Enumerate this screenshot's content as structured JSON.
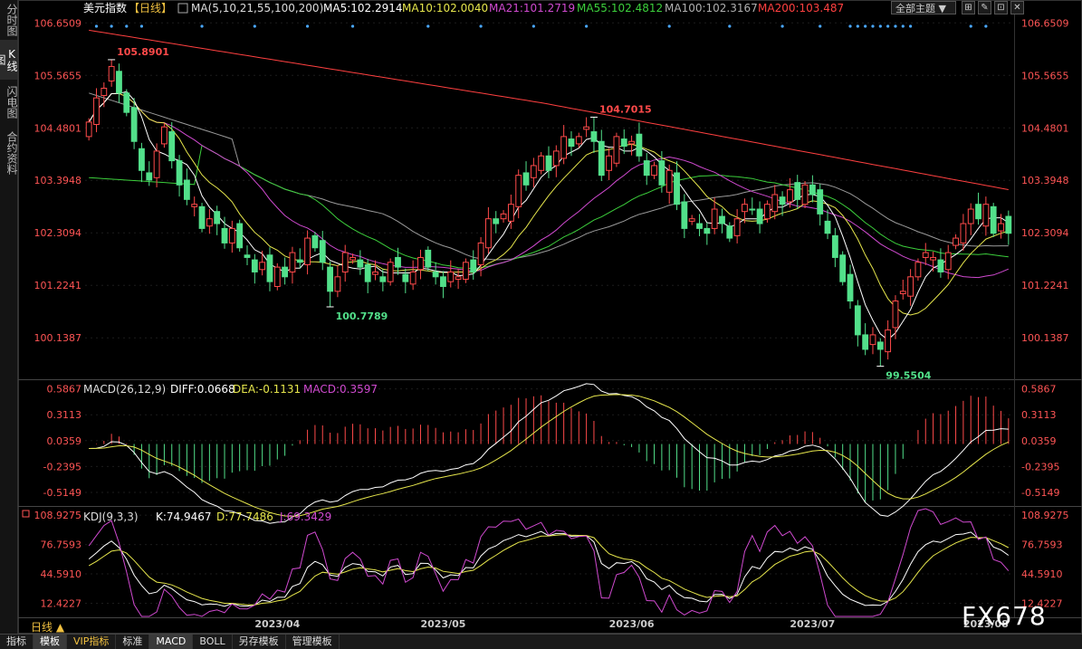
{
  "side_tabs": [
    "分时图",
    "K线图",
    "闪电图",
    "合约资料"
  ],
  "header": {
    "title": "美元指数",
    "period_tag": "【日线】",
    "ma_label": "MA(5,10,21,55,100,200)",
    "ma_values": [
      {
        "label": "MA5:102.2914",
        "color": "#ffffff"
      },
      {
        "label": "MA10:102.0040",
        "color": "#e6e64c"
      },
      {
        "label": "MA21:101.2719",
        "color": "#d04ad0"
      },
      {
        "label": "MA55:102.4812",
        "color": "#3ccf3c"
      },
      {
        "label": "MA100:102.3167",
        "color": "#b0b0b0"
      },
      {
        "label": "MA200:103.487",
        "color": "#ff4040"
      }
    ],
    "theme_button": "全部主题"
  },
  "macd_header": {
    "title": "MACD(26,12,9)",
    "diff": "DIFF:0.0668",
    "dea": "DEA:-0.1131",
    "macd": "MACD:0.3597"
  },
  "kdj_header": {
    "title": "KDJ(9,3,3)",
    "k": "K:74.9467",
    "d": "D:77.7486",
    "j": "J:69.3429"
  },
  "period_label": "日线 ▲",
  "bottom_tabs": [
    "指标",
    "模板",
    "VIP指标",
    "标准",
    "MACD",
    "BOLL",
    "另存模板",
    "管理模板"
  ],
  "watermark": "FX678",
  "colors": {
    "up": "#ff4a4a",
    "down": "#52e08a",
    "text_label": "#ff4a4a",
    "low_label": "#52e08a"
  },
  "chart_data": [
    {
      "type": "candlestick",
      "title": "美元指数【日线】",
      "y_ticks": [
        "106.6509",
        "105.5655",
        "104.4801",
        "103.3948",
        "102.3094",
        "101.2241",
        "100.1387"
      ],
      "ylim": [
        99.3,
        106.75
      ],
      "x_ticks": [
        "2023/04",
        "2023/05",
        "2023/06",
        "2023/07",
        "2023/08"
      ],
      "x_tick_index": [
        25,
        47,
        72,
        96,
        119
      ],
      "annotations": [
        {
          "text": "105.8901",
          "index": 3,
          "value": 105.8901,
          "kind": "high"
        },
        {
          "text": "100.7789",
          "index": 32,
          "value": 100.7789,
          "kind": "low"
        },
        {
          "text": "104.7015",
          "index": 67,
          "value": 104.7015,
          "kind": "high"
        },
        {
          "text": "99.5504",
          "index": 105,
          "value": 99.5504,
          "kind": "low"
        }
      ],
      "closes": [
        104.6,
        105.1,
        105.3,
        105.75,
        105.2,
        104.8,
        104.2,
        103.6,
        103.4,
        104.0,
        104.5,
        103.8,
        103.3,
        103.0,
        102.9,
        102.4,
        102.6,
        102.5,
        102.1,
        102.4,
        102.0,
        101.8,
        101.5,
        101.7,
        101.3,
        101.6,
        101.4,
        101.9,
        101.7,
        102.2,
        102.0,
        101.7,
        101.1,
        101.4,
        101.9,
        101.8,
        101.6,
        101.3,
        101.5,
        101.3,
        101.7,
        101.6,
        101.3,
        101.5,
        101.8,
        101.6,
        101.4,
        101.2,
        101.5,
        101.4,
        101.7,
        101.5,
        102.1,
        102.6,
        102.5,
        102.7,
        102.9,
        103.5,
        103.3,
        103.7,
        103.9,
        103.6,
        104.0,
        104.3,
        104.1,
        104.3,
        104.5,
        104.2,
        103.5,
        103.9,
        104.3,
        104.1,
        104.2,
        103.9,
        103.5,
        103.7,
        103.3,
        103.6,
        102.9,
        102.4,
        102.6,
        102.4,
        102.3,
        102.8,
        102.5,
        102.2,
        102.6,
        102.9,
        102.8,
        102.5,
        102.9,
        103.1,
        102.9,
        103.2,
        103.0,
        103.3,
        103.1,
        102.7,
        102.3,
        101.8,
        101.3,
        100.9,
        100.2,
        99.9,
        100.2,
        99.9,
        100.3,
        100.9,
        101.1,
        101.4,
        101.7,
        101.9,
        101.8,
        101.5,
        101.9,
        102.2,
        102.5,
        102.8,
        102.6,
        102.9,
        102.3,
        102.5,
        102.3
      ]
    },
    {
      "type": "bar",
      "title": "MACD(26,12,9)",
      "y_ticks": [
        "0.5867",
        "0.3113",
        "0.0359",
        "-0.2395",
        "-0.5149"
      ],
      "ylim": [
        -0.65,
        0.66
      ]
    },
    {
      "type": "line",
      "title": "KDJ(9,3,3)",
      "y_ticks": [
        "108.9275",
        "76.7593",
        "44.5910",
        "12.4227"
      ],
      "ylim": [
        -3,
        118
      ],
      "series": [
        {
          "name": "K"
        },
        {
          "name": "D"
        },
        {
          "name": "J"
        }
      ]
    }
  ]
}
